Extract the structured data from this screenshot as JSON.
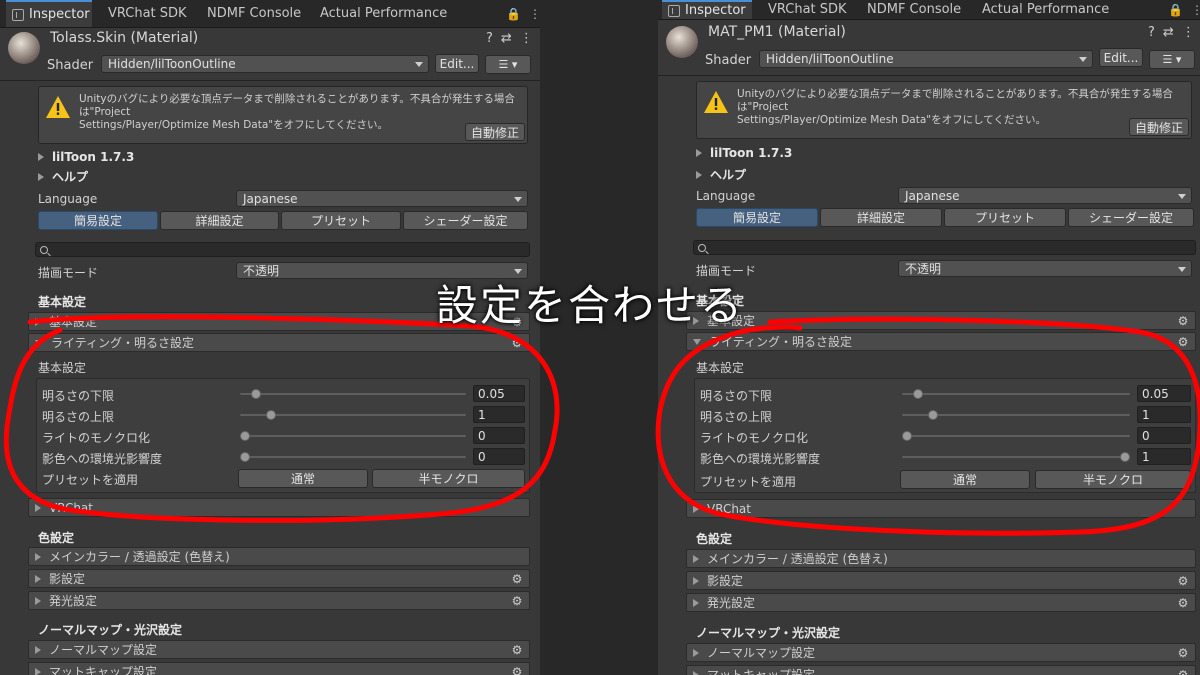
{
  "tabs": [
    "Inspector",
    "VRChat SDK",
    "NDMF Console",
    "Actual Performance"
  ],
  "tab_tools": {
    "lock": "🔒",
    "menu": "⋮"
  },
  "header_icons": {
    "help": "?",
    "settings": "⇄",
    "more": "⋮"
  },
  "left": {
    "material_title": "Tolass.Skin (Material)",
    "shader_label": "Shader",
    "shader_value": "Hidden/lilToonOutline",
    "edit_label": "Edit...",
    "warning": {
      "line1": "Unityのバグにより必要な頂点データまで削除されることがあります。不具合が発生する場合は\"Project",
      "line2": "Settings/Player/Optimize Mesh Data\"をオフにしてください。",
      "fix_label": "自動修正"
    },
    "version": "lilToon 1.7.3",
    "help": "ヘルプ",
    "language_label": "Language",
    "language_value": "Japanese",
    "mode_tabs": [
      "簡易設定",
      "詳細設定",
      "プリセット",
      "シェーダー設定"
    ],
    "render_mode_label": "描画モード",
    "render_mode_value": "不透明",
    "basic_heading": "基本設定",
    "basic_group": "基本設定",
    "lighting_group": "ライティング・明るさ設定",
    "lighting_sub": "基本設定",
    "sliders": [
      {
        "label": "明るさの下限",
        "value": "0.05",
        "level": 0.05
      },
      {
        "label": "明るさの上限",
        "value": "1",
        "level": 0.12
      },
      {
        "label": "ライトのモノクロ化",
        "value": "0",
        "level": 0.0
      },
      {
        "label": "影色への環境光影響度",
        "value": "0",
        "level": 0.0
      }
    ],
    "preset_label": "プリセットを適用",
    "preset_buttons": [
      "通常",
      "半モノクロ"
    ],
    "vrchat_group": "VRChat",
    "color_heading": "色設定",
    "color_groups": [
      "メインカラー / 透過設定 (色替え)",
      "影設定",
      "発光設定"
    ],
    "normal_heading": "ノーマルマップ・光沢設定",
    "normal_groups": [
      "ノーマルマップ設定",
      "マットキャップ設定"
    ]
  },
  "right": {
    "material_title": "MAT_PM1 (Material)",
    "shader_label": "Shader",
    "shader_value": "Hidden/lilToonOutline",
    "edit_label": "Edit...",
    "warning": {
      "line1": "Unityのバグにより必要な頂点データまで削除されることがあります。不具合が発生する場合は\"Project",
      "line2": "Settings/Player/Optimize Mesh Data\"をオフにしてください。",
      "fix_label": "自動修正"
    },
    "version": "lilToon 1.7.3",
    "help": "ヘルプ",
    "language_label": "Language",
    "language_value": "Japanese",
    "mode_tabs": [
      "簡易設定",
      "詳細設定",
      "プリセット",
      "シェーダー設定"
    ],
    "render_mode_label": "描画モード",
    "render_mode_value": "不透明",
    "basic_heading": "基本設定",
    "basic_group": "基本設定",
    "lighting_group": "ライティング・明るさ設定",
    "lighting_sub": "基本設定",
    "sliders": [
      {
        "label": "明るさの下限",
        "value": "0.05",
        "level": 0.05
      },
      {
        "label": "明るさの上限",
        "value": "1",
        "level": 0.12
      },
      {
        "label": "ライトのモノクロ化",
        "value": "0",
        "level": 0.0
      },
      {
        "label": "影色への環境光影響度",
        "value": "1",
        "level": 1.0
      }
    ],
    "preset_label": "プリセットを適用",
    "preset_buttons": [
      "通常",
      "半モノクロ"
    ],
    "vrchat_group": "VRChat",
    "color_heading": "色設定",
    "color_groups": [
      "メインカラー / 透過設定 (色替え)",
      "影設定",
      "発光設定"
    ],
    "normal_heading": "ノーマルマップ・光沢設定",
    "normal_groups": [
      "ノーマルマップ設定",
      "マットキャップ設定"
    ]
  },
  "overlay_caption": "設定を合わせる",
  "colors": {
    "annotation": "#ff0000",
    "selected_tab": "#46607f",
    "panel": "#383838"
  }
}
